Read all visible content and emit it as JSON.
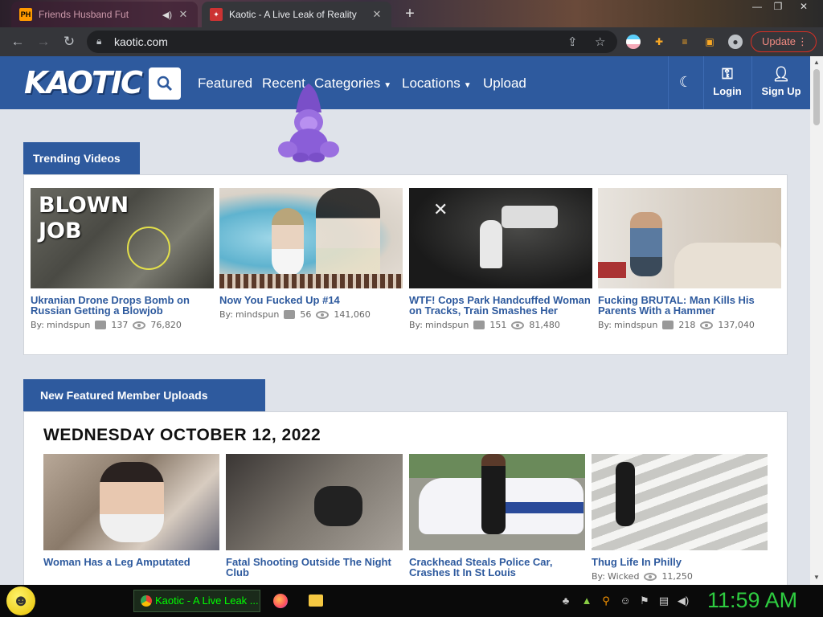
{
  "browser": {
    "tabs": [
      {
        "title": "Friends Husband Fut",
        "favicon": "PH",
        "active": false
      },
      {
        "title": "Kaotic - A Live Leak of Reality",
        "favicon": "kaotic-favicon",
        "active": true
      }
    ],
    "url": "kaotic.com",
    "update_label": "Update"
  },
  "site": {
    "logo": "KAOTIC",
    "nav": [
      {
        "label": "Featured",
        "dropdown": false
      },
      {
        "label": "Recent",
        "dropdown": false
      },
      {
        "label": "Categories",
        "dropdown": true
      },
      {
        "label": "Locations",
        "dropdown": true
      },
      {
        "label": "Upload",
        "dropdown": false
      }
    ],
    "login_label": "Login",
    "signup_label": "Sign Up"
  },
  "trending": {
    "heading": "Trending Videos",
    "videos": [
      {
        "title": "Ukranian Drone Drops Bomb on Russian Getting a Blowjob",
        "thumb_text": "BLOWN JOB",
        "by": "By:",
        "author": "mindspun",
        "comments": "137",
        "views": "76,820"
      },
      {
        "title": "Now You Fucked Up #14",
        "by": "By:",
        "author": "mindspun",
        "comments": "56",
        "views": "141,060"
      },
      {
        "title": "WTF! Cops Park Handcuffed Woman on Tracks, Train Smashes Her",
        "by": "By:",
        "author": "mindspun",
        "comments": "151",
        "views": "81,480"
      },
      {
        "title": "Fucking BRUTAL: Man Kills His Parents With a Hammer",
        "by": "By:",
        "author": "mindspun",
        "comments": "218",
        "views": "137,040"
      }
    ]
  },
  "featured": {
    "heading": "New Featured Member Uploads",
    "date": "WEDNESDAY OCTOBER 12, 2022",
    "videos": [
      {
        "title": "Woman Has a Leg Amputated"
      },
      {
        "title": "Fatal Shooting Outside The Night Club"
      },
      {
        "title": "Crackhead Steals Police Car, Crashes It In St Louis"
      },
      {
        "title": "Thug Life In Philly",
        "by": "By:",
        "author": "Wicked",
        "views": "11,250"
      }
    ]
  },
  "taskbar": {
    "task_label": "Kaotic - A Live Leak ...",
    "clock": "11:59 AM"
  }
}
